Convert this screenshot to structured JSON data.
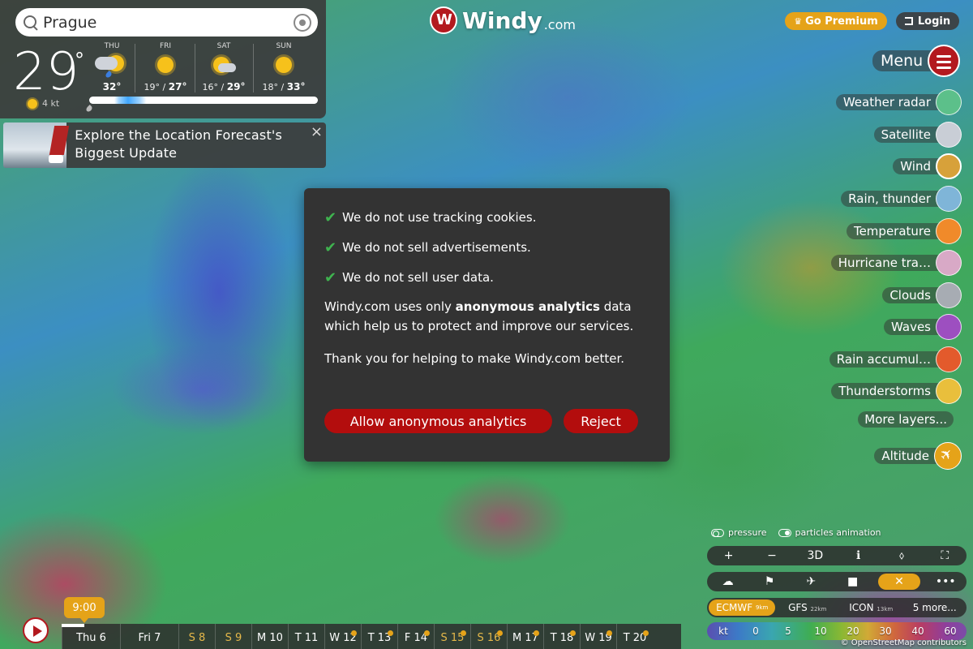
{
  "search": {
    "value": "Prague"
  },
  "current": {
    "temp": "29",
    "degree": "°",
    "wind": "4 kt"
  },
  "forecast": [
    {
      "day": "THU",
      "low": "",
      "sep": "",
      "high": "32°",
      "icon": "sun-cloud-rain-icon"
    },
    {
      "day": "FRI",
      "low": "19°",
      "sep": " / ",
      "high": "27°",
      "icon": "sun-icon"
    },
    {
      "day": "SAT",
      "low": "16°",
      "sep": " / ",
      "high": "29°",
      "icon": "sun-cloud-icon"
    },
    {
      "day": "SUN",
      "low": "18°",
      "sep": " / ",
      "high": "33°",
      "icon": "sun-icon"
    }
  ],
  "promo": {
    "text": "Explore the Location Forecast's Biggest Update",
    "close": "×"
  },
  "logo": {
    "text": "Windy",
    "suffix": ".com"
  },
  "header": {
    "premium": "Go Premium",
    "login": "Login",
    "menu": "Menu"
  },
  "layers": [
    {
      "label": "Weather radar",
      "color": "#5cc08a"
    },
    {
      "label": "Satellite",
      "color": "#c9ced6"
    },
    {
      "label": "Wind",
      "color": "#d7a13a"
    },
    {
      "label": "Rain, thunder",
      "color": "#7fb5d8"
    },
    {
      "label": "Temperature",
      "color": "#f08a2a"
    },
    {
      "label": "Hurricane tra…",
      "color": "#d8a9c6"
    },
    {
      "label": "Clouds",
      "color": "#a7acb3"
    },
    {
      "label": "Waves",
      "color": "#9d4fc0"
    },
    {
      "label": "Rain accumul…",
      "color": "#e35a2c"
    },
    {
      "label": "Thunderstorms",
      "color": "#e9bf3c"
    }
  ],
  "more_layers": "More layers...",
  "altitude": "Altitude",
  "toggles": {
    "pressure": "pressure",
    "particles": "particles animation"
  },
  "controls": {
    "zoom_in": "+",
    "zoom_out": "−",
    "three_d": "3D",
    "info": "ℹ",
    "nav": "⬨",
    "fullscreen": "⛶"
  },
  "tools": {
    "weather": "☁",
    "flag": "⚑",
    "plane": "✈",
    "camera": "■",
    "close": "✕",
    "more": "•••"
  },
  "models": [
    {
      "name": "ECMWF",
      "res": "9km"
    },
    {
      "name": "GFS",
      "res": "22km"
    },
    {
      "name": "ICON",
      "res": "13km"
    }
  ],
  "models_more": "5 more...",
  "scale": [
    "kt",
    "0",
    "5",
    "10",
    "20",
    "30",
    "40",
    "60"
  ],
  "attribution": "© OpenStreetMap contributors",
  "timeline": {
    "time": "9:00",
    "days": [
      {
        "label": "Thu 6",
        "weekend": false,
        "premium": false,
        "wide": true
      },
      {
        "label": "Fri 7",
        "weekend": false,
        "premium": false,
        "wide": true
      },
      {
        "label": "S 8",
        "weekend": true,
        "premium": false,
        "wide": false
      },
      {
        "label": "S 9",
        "weekend": true,
        "premium": false,
        "wide": false
      },
      {
        "label": "M 10",
        "weekend": false,
        "premium": false,
        "wide": false
      },
      {
        "label": "T 11",
        "weekend": false,
        "premium": false,
        "wide": false
      },
      {
        "label": "W 12",
        "weekend": false,
        "premium": true,
        "wide": false
      },
      {
        "label": "T 13",
        "weekend": false,
        "premium": true,
        "wide": false
      },
      {
        "label": "F 14",
        "weekend": false,
        "premium": true,
        "wide": false
      },
      {
        "label": "S 15",
        "weekend": true,
        "premium": true,
        "wide": false
      },
      {
        "label": "S 16",
        "weekend": true,
        "premium": true,
        "wide": false
      },
      {
        "label": "M 17",
        "weekend": false,
        "premium": true,
        "wide": false
      },
      {
        "label": "T 18",
        "weekend": false,
        "premium": true,
        "wide": false
      },
      {
        "label": "W 19",
        "weekend": false,
        "premium": true,
        "wide": false
      },
      {
        "label": "T 20",
        "weekend": false,
        "premium": true,
        "wide": false
      }
    ]
  },
  "consent": {
    "items": [
      "We do not use tracking cookies.",
      "We do not sell advertisements.",
      "We do not sell user data."
    ],
    "para1_pre": "Windy.com uses only ",
    "para1_bold": "anonymous analytics",
    "para1_post": " data which help us to protect and improve our services.",
    "para2": "Thank you for helping to make Windy.com better.",
    "allow": "Allow anonymous analytics",
    "reject": "Reject"
  },
  "colors": {
    "accent": "#e5a319",
    "brand": "#b3191f",
    "check": "#3fb34f",
    "consent_btn": "#b30d0d"
  }
}
